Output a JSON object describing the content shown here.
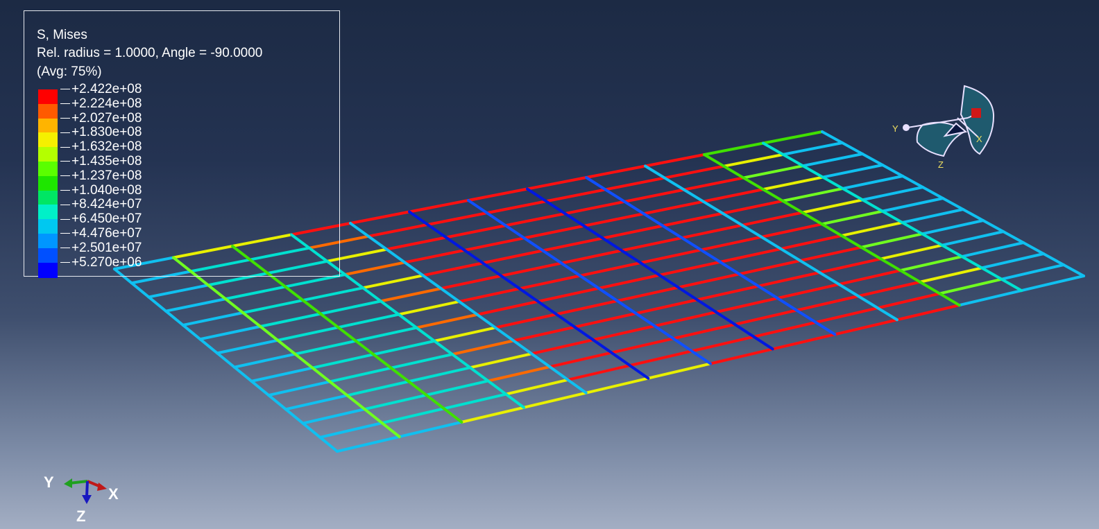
{
  "legend": {
    "title": "S, Mises",
    "subtitle": "Rel. radius = 1.0000, Angle = -90.0000",
    "averaging": "(Avg: 75%)",
    "levels": [
      {
        "label": "+2.422e+08",
        "color": "#ff0000"
      },
      {
        "label": "+2.224e+08",
        "color": "#ff5a00"
      },
      {
        "label": "+2.027e+08",
        "color": "#ffb400"
      },
      {
        "label": "+1.830e+08",
        "color": "#f5f000"
      },
      {
        "label": "+1.632e+08",
        "color": "#b4ff00"
      },
      {
        "label": "+1.435e+08",
        "color": "#5aff00"
      },
      {
        "label": "+1.237e+08",
        "color": "#1ee600"
      },
      {
        "label": "+1.040e+08",
        "color": "#00e664"
      },
      {
        "label": "+8.424e+07",
        "color": "#00f0c8"
      },
      {
        "label": "+6.450e+07",
        "color": "#00c8f0"
      },
      {
        "label": "+4.476e+07",
        "color": "#0096ff"
      },
      {
        "label": "+2.501e+07",
        "color": "#0050ff"
      },
      {
        "label": "+5.270e+06",
        "color": "#0000ff"
      }
    ]
  },
  "triad": {
    "x_label": "X",
    "y_label": "Y",
    "z_label": "Z"
  },
  "view_orientation": {
    "x_label": "X",
    "y_label": "Y",
    "z_label": "Z"
  },
  "colors": {
    "background_top": "#1c2a44",
    "background_bottom": "#a3aec3",
    "legend_border": "#e6e9ef",
    "text": "#ffffff"
  }
}
